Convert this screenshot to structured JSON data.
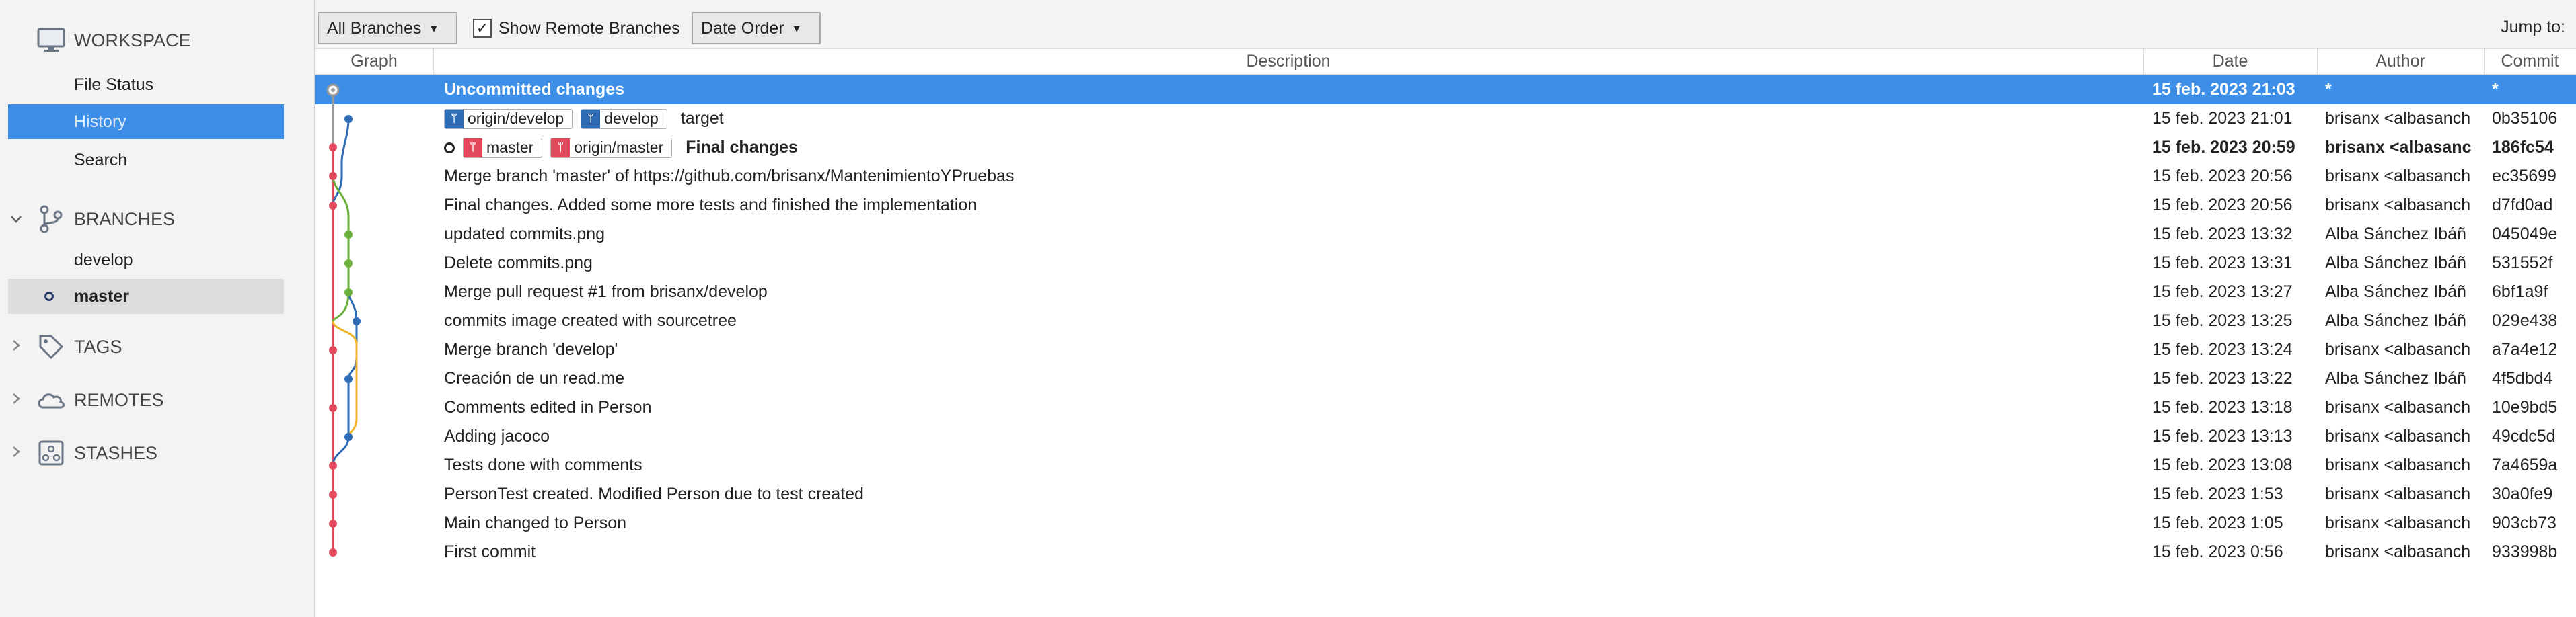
{
  "sidebar": {
    "workspace": {
      "title": "WORKSPACE",
      "items": [
        "File Status",
        "History",
        "Search"
      ]
    },
    "branches": {
      "title": "BRANCHES",
      "items": [
        "develop",
        "master"
      ]
    },
    "tags": {
      "title": "TAGS"
    },
    "remotes": {
      "title": "REMOTES"
    },
    "stashes": {
      "title": "STASHES"
    }
  },
  "toolbar": {
    "branch_filter": "All Branches",
    "show_remote_label": "Show Remote Branches",
    "show_remote_checked": true,
    "order": "Date Order",
    "jump_to": "Jump to:"
  },
  "columns": {
    "graph": "Graph",
    "description": "Description",
    "date": "Date",
    "author": "Author",
    "commit": "Commit"
  },
  "commits": [
    {
      "description": "Uncommitted changes",
      "date": "15 feb. 2023 21:03",
      "author": "*",
      "commit": "*"
    },
    {
      "refs": [
        "origin/develop",
        "develop"
      ],
      "description": "target",
      "date": "15 feb. 2023 21:01",
      "author": "brisanx <albasanch",
      "commit": "0b35106"
    },
    {
      "refs": [
        "master",
        "origin/master"
      ],
      "description": "Final changes",
      "date": "15 feb. 2023 20:59",
      "author": "brisanx <albasanc",
      "commit": "186fc54"
    },
    {
      "description": "Merge branch 'master' of https://github.com/brisanx/MantenimientoYPruebas",
      "date": "15 feb. 2023 20:56",
      "author": "brisanx <albasanch",
      "commit": "ec35699"
    },
    {
      "description": "Final changes. Added some more tests and finished the implementation",
      "date": "15 feb. 2023 20:56",
      "author": "brisanx <albasanch",
      "commit": "d7fd0ad"
    },
    {
      "description": "updated commits.png",
      "date": "15 feb. 2023 13:32",
      "author": "Alba Sánchez Ibáñ",
      "commit": "045049e"
    },
    {
      "description": "Delete commits.png",
      "date": "15 feb. 2023 13:31",
      "author": "Alba Sánchez Ibáñ",
      "commit": "531552f"
    },
    {
      "description": "Merge pull request #1 from brisanx/develop",
      "date": "15 feb. 2023 13:27",
      "author": "Alba Sánchez Ibáñ",
      "commit": "6bf1a9f"
    },
    {
      "description": "commits image created with sourcetree",
      "date": "15 feb. 2023 13:25",
      "author": "Alba Sánchez Ibáñ",
      "commit": "029e438"
    },
    {
      "description": "Merge branch 'develop'",
      "date": "15 feb. 2023 13:24",
      "author": "brisanx <albasanch",
      "commit": "a7a4e12"
    },
    {
      "description": "Creación de un read.me",
      "date": "15 feb. 2023 13:22",
      "author": "Alba Sánchez Ibáñ",
      "commit": "4f5dbd4"
    },
    {
      "description": "Comments edited in Person",
      "date": "15 feb. 2023 13:18",
      "author": "brisanx <albasanch",
      "commit": "10e9bd5"
    },
    {
      "description": "Adding jacoco",
      "date": "15 feb. 2023 13:13",
      "author": "brisanx <albasanch",
      "commit": "49cdc5d"
    },
    {
      "description": "Tests done with comments",
      "date": "15 feb. 2023 13:08",
      "author": "brisanx <albasanch",
      "commit": "7a4659a"
    },
    {
      "description": "PersonTest created. Modified Person due to test created",
      "date": "15 feb. 2023 1:53",
      "author": "brisanx <albasanch",
      "commit": "30a0fe9"
    },
    {
      "description": "Main changed to Person",
      "date": "15 feb. 2023 1:05",
      "author": "brisanx <albasanch",
      "commit": "903cb73"
    },
    {
      "description": "First commit",
      "date": "15 feb. 2023 0:56",
      "author": "brisanx <albasanch",
      "commit": "933998b"
    }
  ],
  "colors": {
    "selection": "#3d8ee6",
    "master": "#e0485c",
    "develop": "#2d6bb4",
    "merge": "#6aae3c",
    "extra": "#f0b429"
  }
}
